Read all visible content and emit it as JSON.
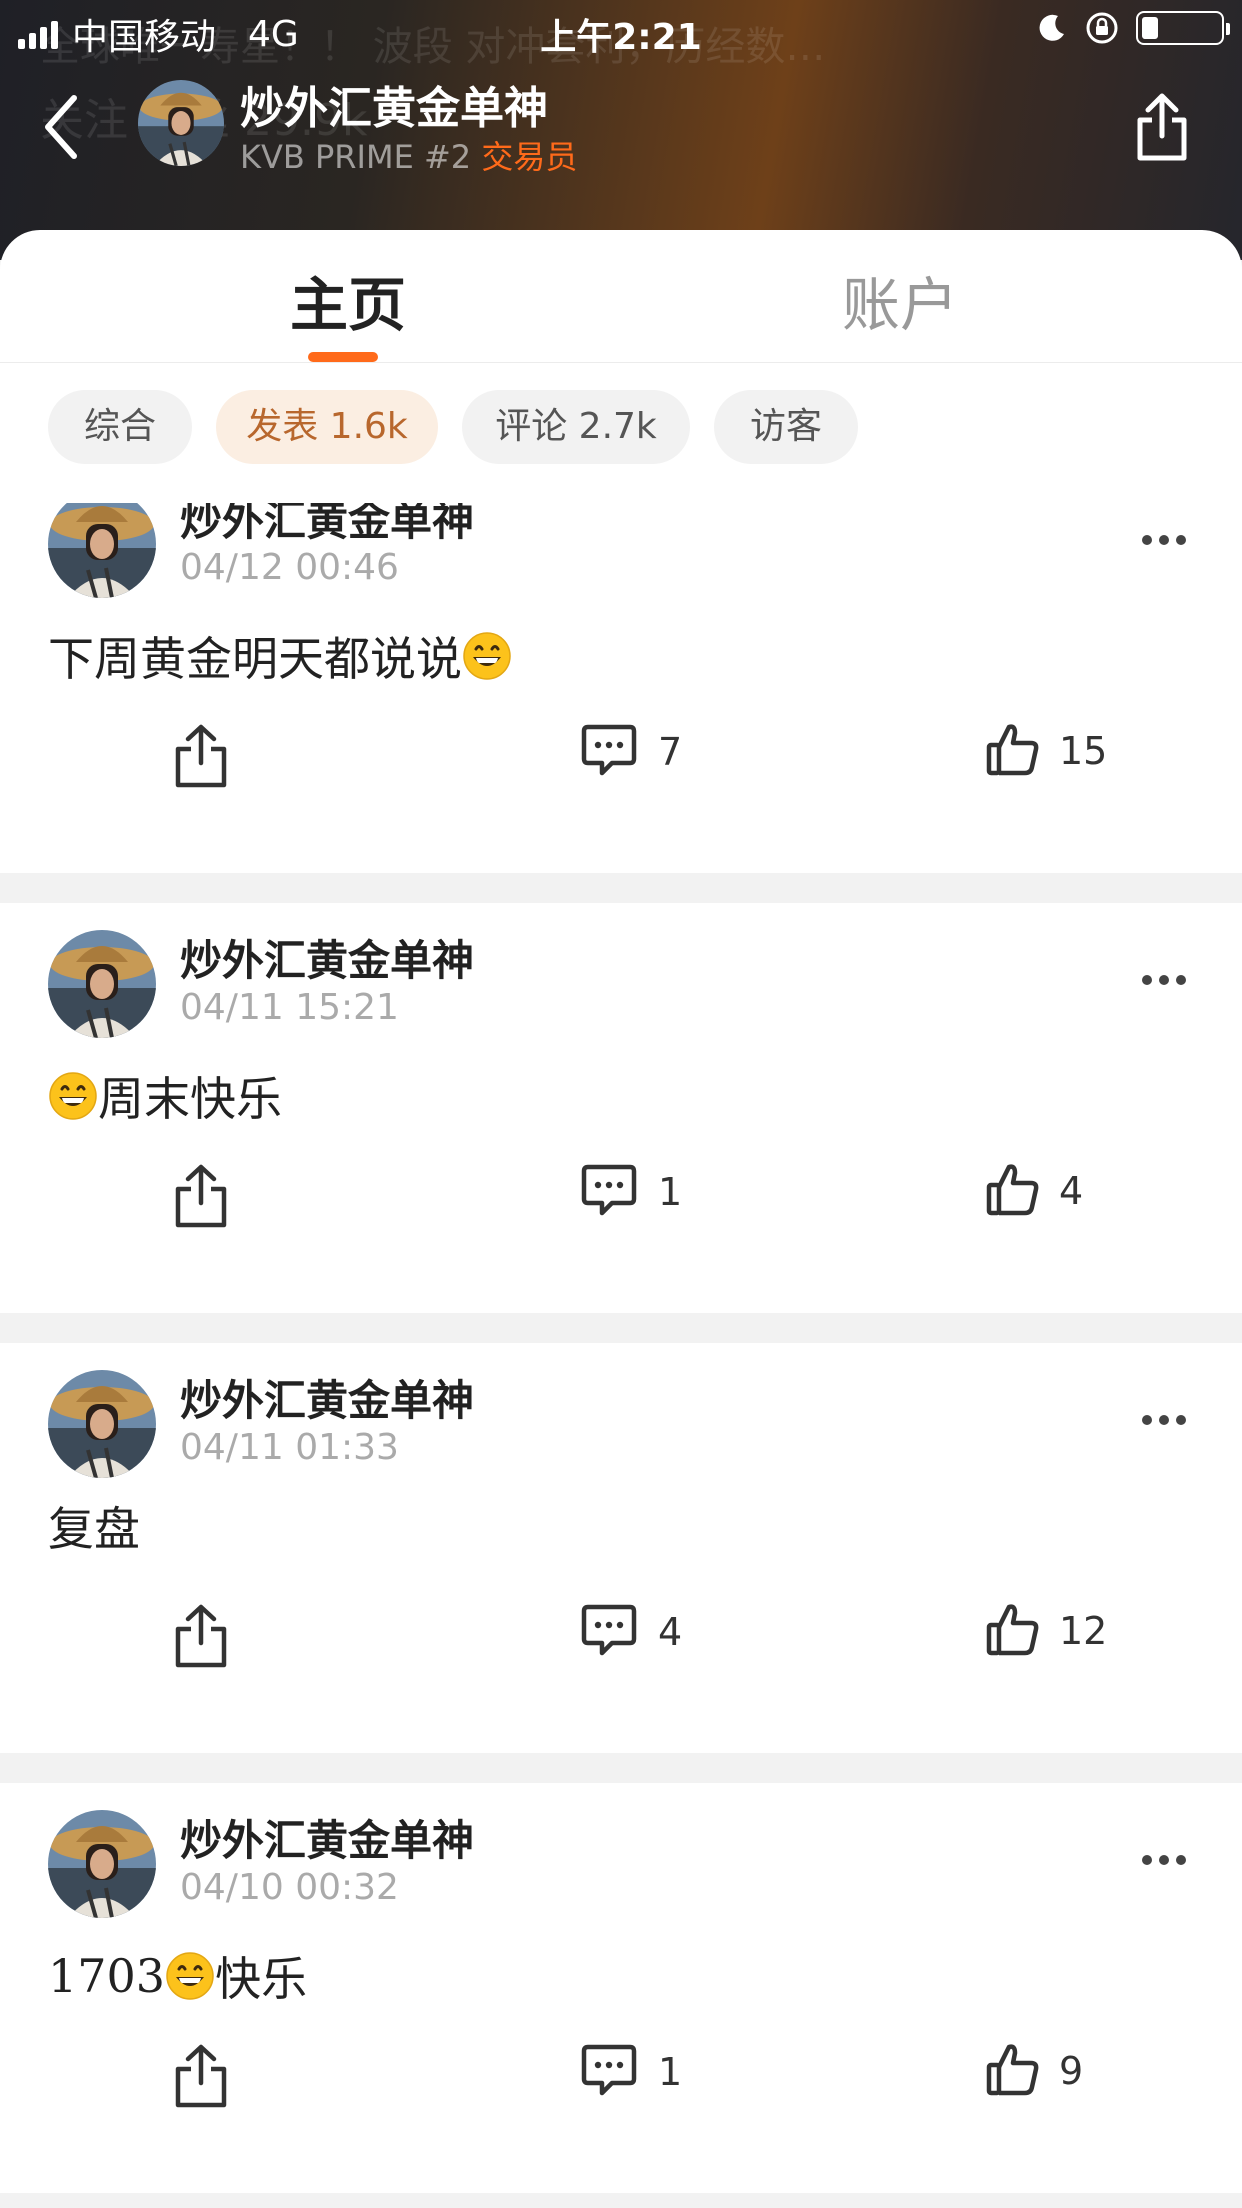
{
  "status_bar": {
    "carrier": "中国移动",
    "network": "4G",
    "time": "上午2:21",
    "battery_percent": 15
  },
  "background_text": {
    "line1": "全球唯一寿星！！ 波段 对冲套利，历经数…",
    "line2": "关注 粉丝 29.9k"
  },
  "header": {
    "name": "炒外汇黄金单神",
    "sub_prefix": "KVB PRIME #2",
    "role": "交易员"
  },
  "tabs": [
    {
      "label": "主页",
      "active": true
    },
    {
      "label": "账户",
      "active": false
    }
  ],
  "filters": [
    {
      "label": "综合",
      "active": false
    },
    {
      "label": "发表 1.6k",
      "active": true
    },
    {
      "label": "评论 2.7k",
      "active": false
    },
    {
      "label": "访客",
      "active": false
    }
  ],
  "posts": [
    {
      "author": "炒外汇黄金单神",
      "time": "04/12 00:46",
      "text_before": "下周黄金明天都说说",
      "emoji": "grinning-face-emoji",
      "text_after": "",
      "comments": "7",
      "likes": "15"
    },
    {
      "author": "炒外汇黄金单神",
      "time": "04/11 15:21",
      "text_before": "",
      "emoji": "grinning-face-emoji",
      "text_after": "周末快乐",
      "comments": "1",
      "likes": "4"
    },
    {
      "author": "炒外汇黄金单神",
      "time": "04/11 01:33",
      "text_before": "复盘",
      "emoji": null,
      "text_after": "",
      "comments": "4",
      "likes": "12"
    },
    {
      "author": "炒外汇黄金单神",
      "time": "04/10 00:32",
      "text_before": "1703",
      "emoji": "grinning-face-emoji",
      "text_after": "快乐",
      "comments": "1",
      "likes": "9"
    }
  ],
  "colors": {
    "accent": "#ff6a1a",
    "chip_active_bg": "#fbeee2",
    "chip_active_text": "#b8672d"
  }
}
